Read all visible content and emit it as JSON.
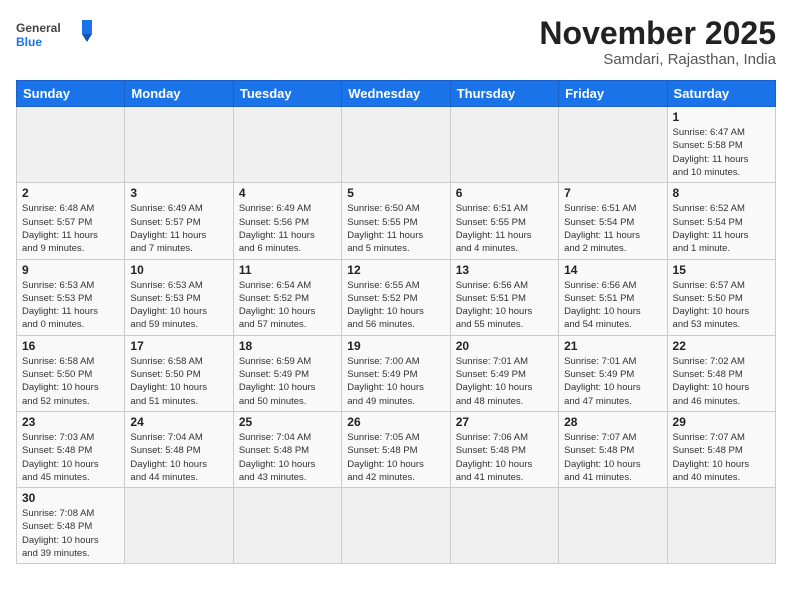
{
  "logo": {
    "text_general": "General",
    "text_blue": "Blue"
  },
  "header": {
    "month_title": "November 2025",
    "location": "Samdari, Rajasthan, India"
  },
  "weekdays": [
    "Sunday",
    "Monday",
    "Tuesday",
    "Wednesday",
    "Thursday",
    "Friday",
    "Saturday"
  ],
  "weeks": [
    [
      {
        "day": "",
        "info": ""
      },
      {
        "day": "",
        "info": ""
      },
      {
        "day": "",
        "info": ""
      },
      {
        "day": "",
        "info": ""
      },
      {
        "day": "",
        "info": ""
      },
      {
        "day": "",
        "info": ""
      },
      {
        "day": "1",
        "info": "Sunrise: 6:47 AM\nSunset: 5:58 PM\nDaylight: 11 hours\nand 10 minutes."
      }
    ],
    [
      {
        "day": "2",
        "info": "Sunrise: 6:48 AM\nSunset: 5:57 PM\nDaylight: 11 hours\nand 9 minutes."
      },
      {
        "day": "3",
        "info": "Sunrise: 6:49 AM\nSunset: 5:57 PM\nDaylight: 11 hours\nand 7 minutes."
      },
      {
        "day": "4",
        "info": "Sunrise: 6:49 AM\nSunset: 5:56 PM\nDaylight: 11 hours\nand 6 minutes."
      },
      {
        "day": "5",
        "info": "Sunrise: 6:50 AM\nSunset: 5:55 PM\nDaylight: 11 hours\nand 5 minutes."
      },
      {
        "day": "6",
        "info": "Sunrise: 6:51 AM\nSunset: 5:55 PM\nDaylight: 11 hours\nand 4 minutes."
      },
      {
        "day": "7",
        "info": "Sunrise: 6:51 AM\nSunset: 5:54 PM\nDaylight: 11 hours\nand 2 minutes."
      },
      {
        "day": "8",
        "info": "Sunrise: 6:52 AM\nSunset: 5:54 PM\nDaylight: 11 hours\nand 1 minute."
      }
    ],
    [
      {
        "day": "9",
        "info": "Sunrise: 6:53 AM\nSunset: 5:53 PM\nDaylight: 11 hours\nand 0 minutes."
      },
      {
        "day": "10",
        "info": "Sunrise: 6:53 AM\nSunset: 5:53 PM\nDaylight: 10 hours\nand 59 minutes."
      },
      {
        "day": "11",
        "info": "Sunrise: 6:54 AM\nSunset: 5:52 PM\nDaylight: 10 hours\nand 57 minutes."
      },
      {
        "day": "12",
        "info": "Sunrise: 6:55 AM\nSunset: 5:52 PM\nDaylight: 10 hours\nand 56 minutes."
      },
      {
        "day": "13",
        "info": "Sunrise: 6:56 AM\nSunset: 5:51 PM\nDaylight: 10 hours\nand 55 minutes."
      },
      {
        "day": "14",
        "info": "Sunrise: 6:56 AM\nSunset: 5:51 PM\nDaylight: 10 hours\nand 54 minutes."
      },
      {
        "day": "15",
        "info": "Sunrise: 6:57 AM\nSunset: 5:50 PM\nDaylight: 10 hours\nand 53 minutes."
      }
    ],
    [
      {
        "day": "16",
        "info": "Sunrise: 6:58 AM\nSunset: 5:50 PM\nDaylight: 10 hours\nand 52 minutes."
      },
      {
        "day": "17",
        "info": "Sunrise: 6:58 AM\nSunset: 5:50 PM\nDaylight: 10 hours\nand 51 minutes."
      },
      {
        "day": "18",
        "info": "Sunrise: 6:59 AM\nSunset: 5:49 PM\nDaylight: 10 hours\nand 50 minutes."
      },
      {
        "day": "19",
        "info": "Sunrise: 7:00 AM\nSunset: 5:49 PM\nDaylight: 10 hours\nand 49 minutes."
      },
      {
        "day": "20",
        "info": "Sunrise: 7:01 AM\nSunset: 5:49 PM\nDaylight: 10 hours\nand 48 minutes."
      },
      {
        "day": "21",
        "info": "Sunrise: 7:01 AM\nSunset: 5:49 PM\nDaylight: 10 hours\nand 47 minutes."
      },
      {
        "day": "22",
        "info": "Sunrise: 7:02 AM\nSunset: 5:48 PM\nDaylight: 10 hours\nand 46 minutes."
      }
    ],
    [
      {
        "day": "23",
        "info": "Sunrise: 7:03 AM\nSunset: 5:48 PM\nDaylight: 10 hours\nand 45 minutes."
      },
      {
        "day": "24",
        "info": "Sunrise: 7:04 AM\nSunset: 5:48 PM\nDaylight: 10 hours\nand 44 minutes."
      },
      {
        "day": "25",
        "info": "Sunrise: 7:04 AM\nSunset: 5:48 PM\nDaylight: 10 hours\nand 43 minutes."
      },
      {
        "day": "26",
        "info": "Sunrise: 7:05 AM\nSunset: 5:48 PM\nDaylight: 10 hours\nand 42 minutes."
      },
      {
        "day": "27",
        "info": "Sunrise: 7:06 AM\nSunset: 5:48 PM\nDaylight: 10 hours\nand 41 minutes."
      },
      {
        "day": "28",
        "info": "Sunrise: 7:07 AM\nSunset: 5:48 PM\nDaylight: 10 hours\nand 41 minutes."
      },
      {
        "day": "29",
        "info": "Sunrise: 7:07 AM\nSunset: 5:48 PM\nDaylight: 10 hours\nand 40 minutes."
      }
    ],
    [
      {
        "day": "30",
        "info": "Sunrise: 7:08 AM\nSunset: 5:48 PM\nDaylight: 10 hours\nand 39 minutes."
      },
      {
        "day": "",
        "info": ""
      },
      {
        "day": "",
        "info": ""
      },
      {
        "day": "",
        "info": ""
      },
      {
        "day": "",
        "info": ""
      },
      {
        "day": "",
        "info": ""
      },
      {
        "day": "",
        "info": ""
      }
    ]
  ]
}
